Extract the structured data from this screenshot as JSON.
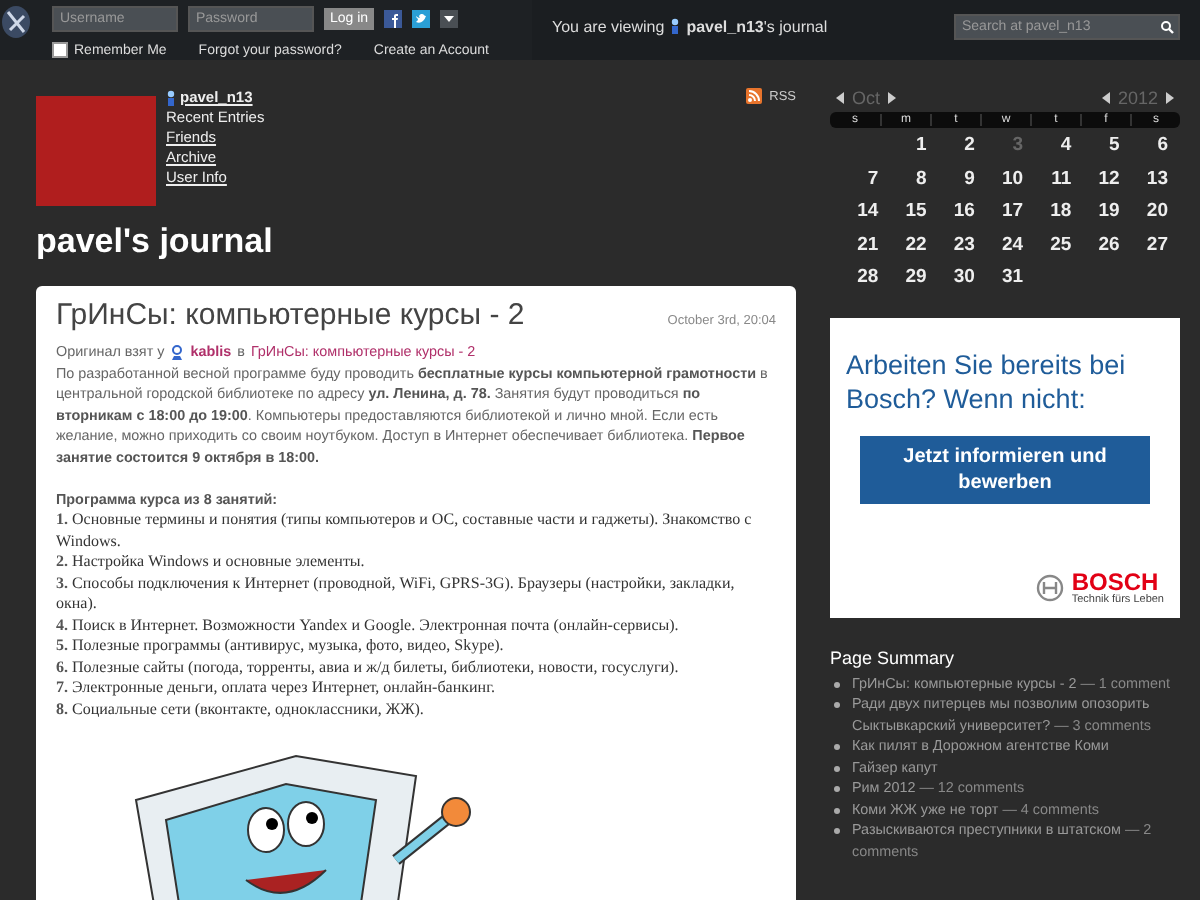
{
  "top_bar": {
    "username_placeholder": "Username",
    "password_placeholder": "Password",
    "login_button": "Log in",
    "remember_me": {
      "label": "Remember Me",
      "checked": false
    },
    "forgot_link": "Forgot your password?",
    "create_link": "Create an Account",
    "viewing_prefix": "You are viewing",
    "viewing_user": "pavel_n13",
    "viewing_suffix": "'s journal",
    "search_placeholder": "Search at pavel_n13"
  },
  "profile": {
    "username": "pavel_n13",
    "links": [
      {
        "label": "Recent Entries",
        "selected": true
      },
      {
        "label": "Friends",
        "selected": false
      },
      {
        "label": "Archive",
        "selected": false
      },
      {
        "label": "User Info",
        "selected": false
      }
    ],
    "rss": "RSS"
  },
  "journal_title": "pavel's journal",
  "post": {
    "title": "ГрИнСы: компьютерные курсы - 2",
    "date": "October 3rd, 20:04",
    "source_prefix": "Оригинал взят у",
    "source_user": "kablis",
    "source_in": "в",
    "source_link": "ГрИнСы: компьютерные курсы - 2",
    "intro": "По разработанной весной программе буду проводить **бесплатные курсы компьютерной грамотности** в центральной городской библиотеке по адресу **ул. Ленина, д. 78.** Занятия будут проводиться **по вторникам с 18:00 до 19:00**. Компьютеры предоставляются библиотекой и лично мной. Если есть желание, можно приходить со своим ноутбуком. Доступ в Интернет обеспечивает библиотека. **Первое занятие состоится 9 октября в 18:00.**",
    "program_heading": "Программа курса из 8 занятий:",
    "program_items": [
      "**1.** Основные термины и понятия (типы компьютеров и ОС, составные части и гаджеты). Знакомство с Windows.",
      "**2.** Настройка Windows и основные элементы.",
      "**3.** Способы подключения к Интернет (проводной, WiFi, GPRS-3G). Браузеры (настройки, закладки, окна).",
      "**4.** Поиск в Интернет. Возможности Yandex и Google. Электронная почта (онлайн-сервисы).",
      "**5.** Полезные программы (антивирус, музыка, фото, видео, Skype).",
      "**6.** Полезные сайты (погода, торренты, авиа и ж/д билеты, библиотеки, новости, госуслуги).",
      "**7.** Электронные деньги, оплата через Интернет, онлайн-банкинг.",
      "**8.** Социальные сети (вконтакте, одноклассники, ЖЖ)."
    ]
  },
  "calendar": {
    "month": "Oct",
    "year": "2012",
    "weekdays": [
      "s",
      "m",
      "t",
      "w",
      "t",
      "f",
      "s"
    ],
    "days": [
      {
        "label": "1",
        "current": false
      },
      {
        "label": "2",
        "current": false
      },
      {
        "label": "3",
        "current": true
      },
      {
        "label": "4",
        "current": false
      },
      {
        "label": "5",
        "current": false
      },
      {
        "label": "6",
        "current": false
      },
      {
        "label": "7",
        "current": false
      },
      {
        "label": "8",
        "current": false
      },
      {
        "label": "9",
        "current": false
      },
      {
        "label": "10",
        "current": false
      },
      {
        "label": "11",
        "current": false
      },
      {
        "label": "12",
        "current": false
      },
      {
        "label": "13",
        "current": false
      },
      {
        "label": "14",
        "current": false
      },
      {
        "label": "15",
        "current": false
      },
      {
        "label": "16",
        "current": false
      },
      {
        "label": "17",
        "current": false
      },
      {
        "label": "18",
        "current": false
      },
      {
        "label": "19",
        "current": false
      },
      {
        "label": "20",
        "current": false
      },
      {
        "label": "21",
        "current": false
      },
      {
        "label": "22",
        "current": false
      },
      {
        "label": "23",
        "current": false
      },
      {
        "label": "24",
        "current": false
      },
      {
        "label": "25",
        "current": false
      },
      {
        "label": "26",
        "current": false
      },
      {
        "label": "27",
        "current": false
      },
      {
        "label": "28",
        "current": false
      },
      {
        "label": "29",
        "current": false
      },
      {
        "label": "30",
        "current": false
      },
      {
        "label": "31",
        "current": false
      }
    ]
  },
  "ad": {
    "headline": "Arbeiten Sie bereits bei Bosch? Wenn nicht:",
    "button": "Jetzt informieren und bewerben",
    "brand": "BOSCH",
    "slogan": "Technik fürs Leben"
  },
  "page_summary": {
    "title": "Page Summary",
    "items": [
      {
        "link": "ГрИнСы: компьютерные курсы - 2",
        "comments": "— 1 comment"
      },
      {
        "link": "Ради двух питерцев мы позволим опозорить Сыктывкарский университет?",
        "comments": "— 3 comments"
      },
      {
        "link": "Как пилят в Дорожном агентстве Коми"
      },
      {
        "link": "Гайзер капут"
      },
      {
        "link": "Рим 2012",
        "comments": "— 12 comments"
      },
      {
        "link": "Коми ЖЖ уже не торт",
        "comments": "— 4 comments"
      },
      {
        "link": "Разыскиваются преступники в штатском",
        "comments": "— 2 comments"
      }
    ]
  }
}
